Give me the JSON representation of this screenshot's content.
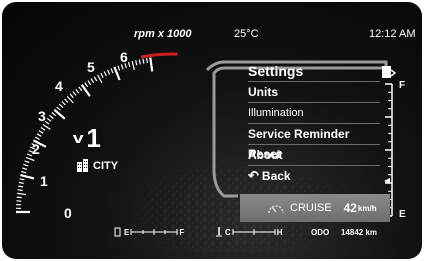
{
  "header": {
    "rpm_unit": "rpm x 1000",
    "temperature": "25°C",
    "time": "12:12 AM"
  },
  "tachometer": {
    "ticks": [
      "0",
      "1",
      "2",
      "3",
      "4",
      "5",
      "6"
    ]
  },
  "drive": {
    "gear": "1",
    "mode": "CITY"
  },
  "menu": {
    "title": "Settings",
    "items": [
      {
        "label": "Units"
      },
      {
        "label": "Illumination"
      },
      {
        "label": "Service Reminder Reset"
      },
      {
        "label": "About"
      },
      {
        "label": "Back"
      }
    ]
  },
  "fuel_gauge": {
    "full": "F",
    "empty": "E"
  },
  "cruise": {
    "label": "CRUISE",
    "speed": "42",
    "unit": "km/h"
  },
  "bottom": {
    "fuel_e": "E",
    "fuel_f": "F",
    "temp_c": "C",
    "temp_h": "H",
    "odo_label": "ODO",
    "odo_value": "14842 km"
  },
  "colors": {
    "background": "#0b0b0b",
    "text": "#ffffff",
    "highlight": "#7c7c7c",
    "redline": "#cc1f1f"
  }
}
